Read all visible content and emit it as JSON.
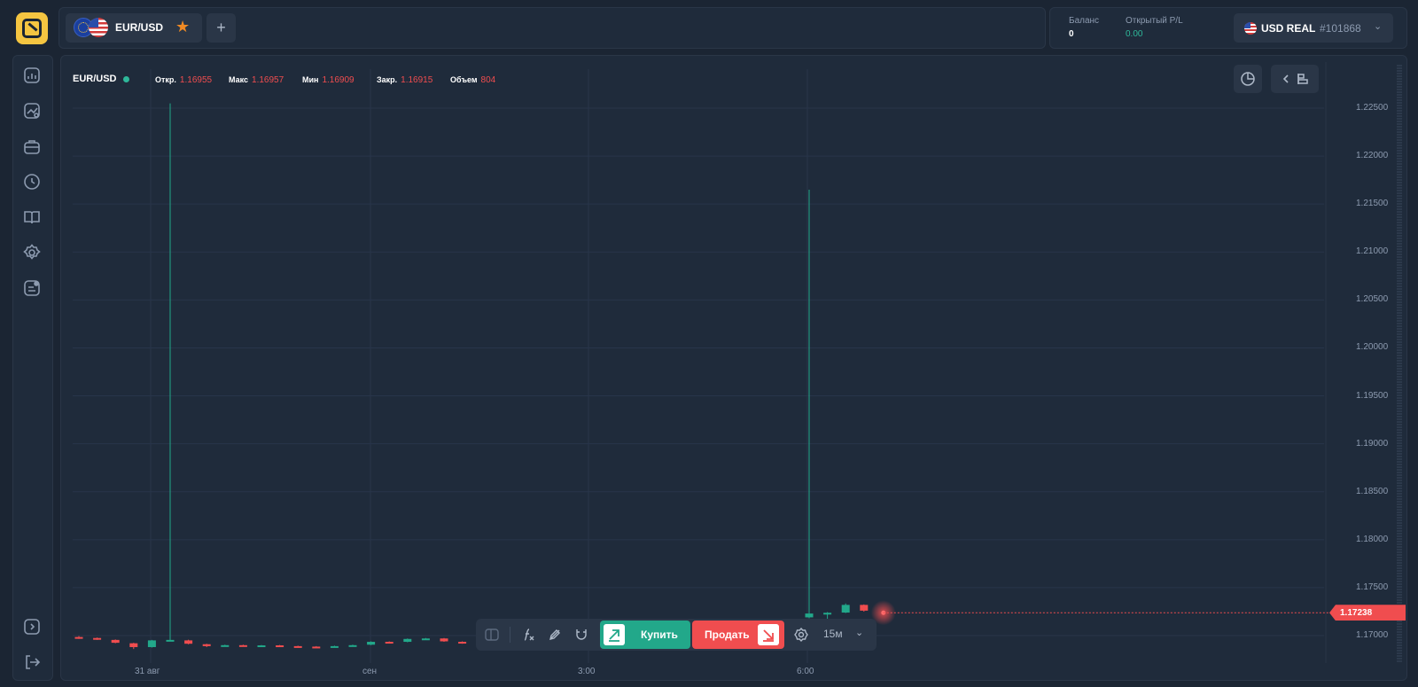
{
  "header": {
    "asset_tab": {
      "name": "EUR/USD",
      "favorite_icon": "star-icon"
    },
    "add_tab_label": "+",
    "balance": {
      "label": "Баланс",
      "value": "0"
    },
    "open_pl": {
      "label": "Открытый P/L",
      "value": "0.00"
    },
    "account": {
      "currency": "USD REAL",
      "id": "#101868"
    }
  },
  "sidebar": {
    "items": [
      {
        "icon": "chart-icon"
      },
      {
        "icon": "analytics-icon"
      },
      {
        "icon": "briefcase-icon"
      },
      {
        "icon": "history-icon"
      },
      {
        "icon": "education-icon"
      },
      {
        "icon": "settings-icon"
      },
      {
        "icon": "news-icon"
      }
    ],
    "bottom": [
      {
        "icon": "collapse-panel-icon"
      },
      {
        "icon": "logout-icon"
      }
    ]
  },
  "chart_header": {
    "pair": "EUR/USD",
    "open_label": "Откр.",
    "open": "1.16955",
    "high_label": "Макс",
    "high": "1.16957",
    "low_label": "Мин",
    "low": "1.16909",
    "close_label": "Закр.",
    "close": "1.16915",
    "volume_label": "Объем",
    "volume": "804"
  },
  "current_price": "1.17238",
  "trade_bar": {
    "buy_label": "Купить",
    "sell_label": "Продать",
    "timeframe": "15м"
  },
  "colors": {
    "up": "#22a88a",
    "down": "#f04d4f",
    "background": "#1b2533",
    "panel": "#1f2b3b",
    "logo": "#f5c541"
  },
  "chart_data": {
    "type": "candlestick",
    "y_ticks": [
      "1.22500",
      "1.22000",
      "1.21500",
      "1.21000",
      "1.20500",
      "1.20000",
      "1.19500",
      "1.19000",
      "1.18500",
      "1.18000",
      "1.17500",
      "1.17000"
    ],
    "ylim": [
      1.1685,
      1.2275
    ],
    "x_ticks": [
      "31 авг",
      "сен",
      "3:00",
      "6:00"
    ],
    "last_price": 1.17238,
    "candles": [
      {
        "o": 1.16985,
        "c": 1.16975,
        "h": 1.16995,
        "l": 1.16965
      },
      {
        "o": 1.16975,
        "c": 1.1696,
        "h": 1.1698,
        "l": 1.16955
      },
      {
        "o": 1.16955,
        "c": 1.16925,
        "h": 1.1696,
        "l": 1.1692
      },
      {
        "o": 1.1692,
        "c": 1.1688,
        "h": 1.16925,
        "l": 1.1686
      },
      {
        "o": 1.1688,
        "c": 1.1695,
        "h": 1.16955,
        "l": 1.16875
      },
      {
        "o": 1.16955,
        "c": 1.16955,
        "h": 1.2255,
        "l": 1.1695
      },
      {
        "o": 1.1695,
        "c": 1.16915,
        "h": 1.16957,
        "l": 1.16909
      },
      {
        "o": 1.1691,
        "c": 1.1689,
        "h": 1.16915,
        "l": 1.1688
      },
      {
        "o": 1.16895,
        "c": 1.169,
        "h": 1.16905,
        "l": 1.16885
      },
      {
        "o": 1.169,
        "c": 1.16895,
        "h": 1.16905,
        "l": 1.1689
      },
      {
        "o": 1.16892,
        "c": 1.16898,
        "h": 1.16902,
        "l": 1.16888
      },
      {
        "o": 1.16898,
        "c": 1.1689,
        "h": 1.16902,
        "l": 1.16885
      },
      {
        "o": 1.1689,
        "c": 1.16885,
        "h": 1.16895,
        "l": 1.1688
      },
      {
        "o": 1.16885,
        "c": 1.1688,
        "h": 1.1689,
        "l": 1.16875
      },
      {
        "o": 1.1688,
        "c": 1.1689,
        "h": 1.16895,
        "l": 1.16875
      },
      {
        "o": 1.1689,
        "c": 1.169,
        "h": 1.16905,
        "l": 1.16885
      },
      {
        "o": 1.16905,
        "c": 1.16935,
        "h": 1.1694,
        "l": 1.169
      },
      {
        "o": 1.16935,
        "c": 1.1693,
        "h": 1.1694,
        "l": 1.16925
      },
      {
        "o": 1.16935,
        "c": 1.16965,
        "h": 1.1697,
        "l": 1.1693
      },
      {
        "o": 1.16965,
        "c": 1.1697,
        "h": 1.16975,
        "l": 1.1696
      },
      {
        "o": 1.1697,
        "c": 1.1694,
        "h": 1.16975,
        "l": 1.16935
      },
      {
        "o": 1.16935,
        "c": 1.1692,
        "h": 1.1694,
        "l": 1.16915
      },
      {
        "o": 1.16918,
        "c": 1.1691,
        "h": 1.16922,
        "l": 1.16905
      },
      null,
      null,
      null,
      null,
      null,
      null,
      null,
      null,
      null,
      null,
      null,
      null,
      null,
      null,
      null,
      null,
      null,
      {
        "o": 1.1719,
        "c": 1.1723,
        "h": 1.2165,
        "l": 1.1718
      },
      {
        "o": 1.17232,
        "c": 1.17238,
        "h": 1.17245,
        "l": 1.17165
      },
      {
        "o": 1.1724,
        "c": 1.1732,
        "h": 1.17335,
        "l": 1.17235
      },
      {
        "o": 1.1732,
        "c": 1.1726,
        "h": 1.17325,
        "l": 1.1725
      }
    ]
  }
}
